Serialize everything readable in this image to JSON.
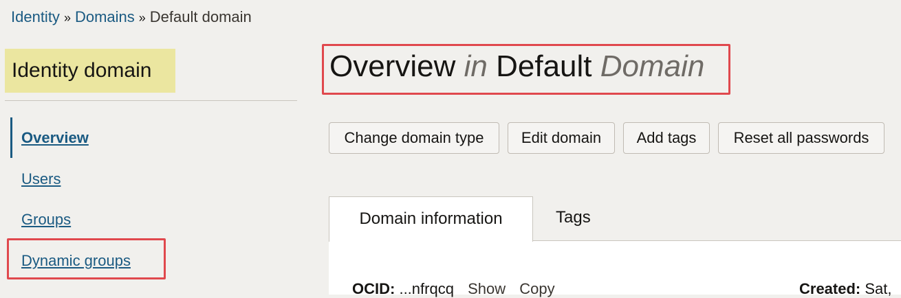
{
  "breadcrumb": {
    "items": [
      "Identity",
      "Domains"
    ],
    "separator": "»",
    "current": "Default domain"
  },
  "sidebar": {
    "title": "Identity domain",
    "items": [
      {
        "label": "Overview",
        "active": true
      },
      {
        "label": "Users"
      },
      {
        "label": "Groups"
      },
      {
        "label": "Dynamic groups"
      }
    ]
  },
  "header": {
    "title_part1": "Overview",
    "title_in": "in",
    "title_part2": "Default",
    "title_part3": "Domain"
  },
  "toolbar": {
    "change_type": "Change domain type",
    "edit": "Edit domain",
    "add_tags": "Add tags",
    "reset_passwords": "Reset all passwords"
  },
  "tabs": [
    {
      "label": "Domain information",
      "active": true
    },
    {
      "label": "Tags"
    }
  ],
  "details": {
    "ocid_label": "OCID:",
    "ocid_value": "...nfrqcq",
    "show": "Show",
    "copy": "Copy",
    "created_label": "Created:",
    "created_value": "Sat,"
  },
  "colors": {
    "link": "#1a5a82",
    "highlight_yellow": "#ebe6a0",
    "annotation_red": "#e0484d"
  }
}
